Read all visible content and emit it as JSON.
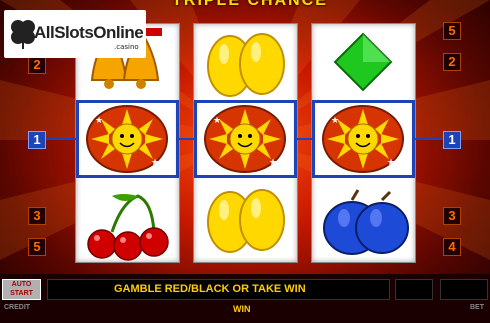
{
  "title": "TRIPLE CHANCE",
  "logo": {
    "brand": "AllSlotsOnline",
    "sub": ".casino"
  },
  "reels": [
    {
      "symbols": [
        "bell-icon",
        "sun-icon",
        "cherry-icon"
      ]
    },
    {
      "symbols": [
        "lemon-icon",
        "sun-icon",
        "lemon-icon"
      ]
    },
    {
      "symbols": [
        "diamond-icon",
        "sun-icon",
        "plum-icon"
      ]
    }
  ],
  "line_numbers": {
    "left": [
      "2",
      "1",
      "3",
      "5"
    ],
    "right": [
      "5",
      "2",
      "1",
      "3",
      "4"
    ]
  },
  "controls": {
    "auto_start": [
      "AUTO",
      "START"
    ],
    "message": "GAMBLE RED/BLACK OR TAKE WIN",
    "credit_label": "CREDIT",
    "bet_label": "BET",
    "win_label": "WIN"
  },
  "colors": {
    "accent": "#1d43b8",
    "background": "#c41800",
    "text": "#ffcc00"
  }
}
